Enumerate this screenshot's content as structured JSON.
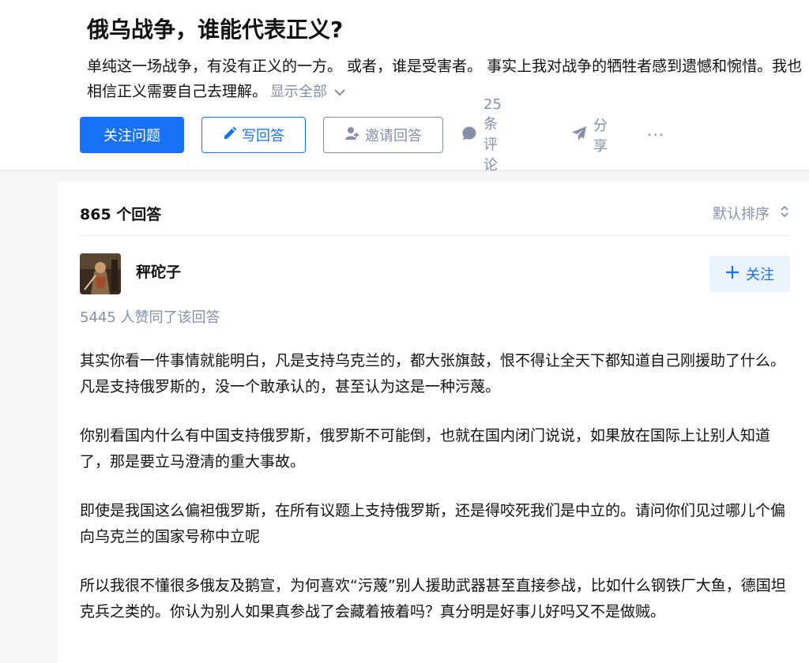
{
  "question": {
    "title": "俄乌战争，谁能代表正义?",
    "detail": "单纯这一场战争，有没有正义的一方。 或者，谁是受害者。 事实上我对战争的牺牲者感到遗憾和惋惜。我也相信正义需要自己去理解。",
    "show_all": "显示全部"
  },
  "actions": {
    "follow": "关注问题",
    "write": "写回答",
    "invite": "邀请回答",
    "comments": "25 条评论",
    "share": "分享",
    "more": "···"
  },
  "answers": {
    "count": "865 个回答",
    "sort": "默认排序"
  },
  "answer": {
    "author": "秤砣子",
    "follow": "关注",
    "votes": "5445 人赞同了该回答",
    "paragraphs": [
      "其实你看一件事情就能明白，凡是支持乌克兰的，都大张旗鼓，恨不得让全天下都知道自己刚援助了什么。凡是支持俄罗斯的，没一个敢承认的，甚至认为这是一种污蔑。",
      "你别看国内什么有中国支持俄罗斯，俄罗斯不可能倒，也就在国内闭门说说，如果放在国际上让别人知道了，那是要立马澄清的重大事故。",
      "即使是我国这么偏袒俄罗斯，在所有议题上支持俄罗斯，还是得咬死我们是中立的。请问你们见过哪儿个偏向乌克兰的国家号称中立呢",
      "所以我很不懂很多俄友及鹅宣，为何喜欢“污蔑”别人援助武器甚至直接参战，比如什么钢铁厂大鱼，德国坦克兵之类的。你认为别人如果真参战了会藏着掖着吗？真分明是好事儿好吗又不是做贼。"
    ]
  },
  "colors": {
    "primary": "#1772f6",
    "muted": "#8590a6",
    "text": "#121212"
  },
  "icons": [
    "pencil-icon",
    "invite-user-icon",
    "comment-icon",
    "share-icon",
    "chevron-down-icon",
    "sort-icon",
    "plus-icon"
  ]
}
